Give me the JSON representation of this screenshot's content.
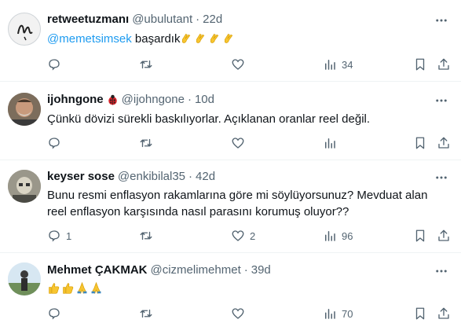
{
  "colors": {
    "text": "#0f1419",
    "muted": "#536471",
    "accent": "#1d9bf0",
    "divider": "#eff3f4"
  },
  "tweets": [
    {
      "display_name": "retweetuzmanı",
      "handle": "@ubulutant",
      "separator": "·",
      "time": "22d",
      "mention": "@memetsimsek",
      "text": "başardık",
      "emojis": [
        "clapping-hands",
        "clapping-hands",
        "clapping-hands",
        "clapping-hands"
      ],
      "replies": "",
      "likes": "",
      "views": "34"
    },
    {
      "display_name": "ijohngone",
      "badge_icon": "ladybug-icon",
      "handle": "@ijohngone",
      "separator": "·",
      "time": "10d",
      "text": "Çünkü dövizi sürekli baskılıyorlar. Açıklanan oranlar reel değil.",
      "replies": "",
      "likes": "",
      "views": ""
    },
    {
      "display_name": "keyser sose",
      "handle": "@enkibilal35",
      "separator": "·",
      "time": "42d",
      "text_line1": "Bunu resmi enflasyon rakamlarına göre mi söylüyorsunuz? Mevduat alan",
      "text_line2": "reel enflasyon karşısında nasıl parasını korumuş oluyor??",
      "replies": "1",
      "likes": "2",
      "views": "96"
    },
    {
      "display_name": "Mehmet ÇAKMAK",
      "handle": "@cizmelimehmet",
      "separator": "·",
      "time": "39d",
      "emojis": [
        "thumbs-up",
        "thumbs-up",
        "folded-hands",
        "folded-hands"
      ],
      "replies": "",
      "likes": "",
      "views": "70"
    }
  ]
}
